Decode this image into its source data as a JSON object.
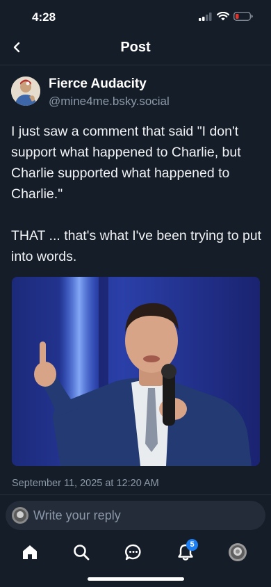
{
  "status_bar": {
    "time": "4:28"
  },
  "nav": {
    "title": "Post"
  },
  "post": {
    "author_name": "Fierce Audacity",
    "author_handle": "@mine4me.bsky.social",
    "paragraph_1": "I just saw a comment that said \"I don't support what happened to Charlie, but Charlie supported what happened to Charlie.\"",
    "paragraph_2": "THAT ... that's what I've been trying to put into words.",
    "timestamp": "September 11, 2025 at 12:20 AM"
  },
  "reply": {
    "placeholder": "Write your reply"
  },
  "tab_bar": {
    "notification_count": "5",
    "items": [
      "home-icon",
      "search-icon",
      "chat-icon",
      "bell-icon",
      "profile-avatar"
    ]
  },
  "colors": {
    "background": "#151d28",
    "accent": "#1d7ef2",
    "muted_text": "#8b98a8",
    "battery_low": "#e5332a"
  }
}
